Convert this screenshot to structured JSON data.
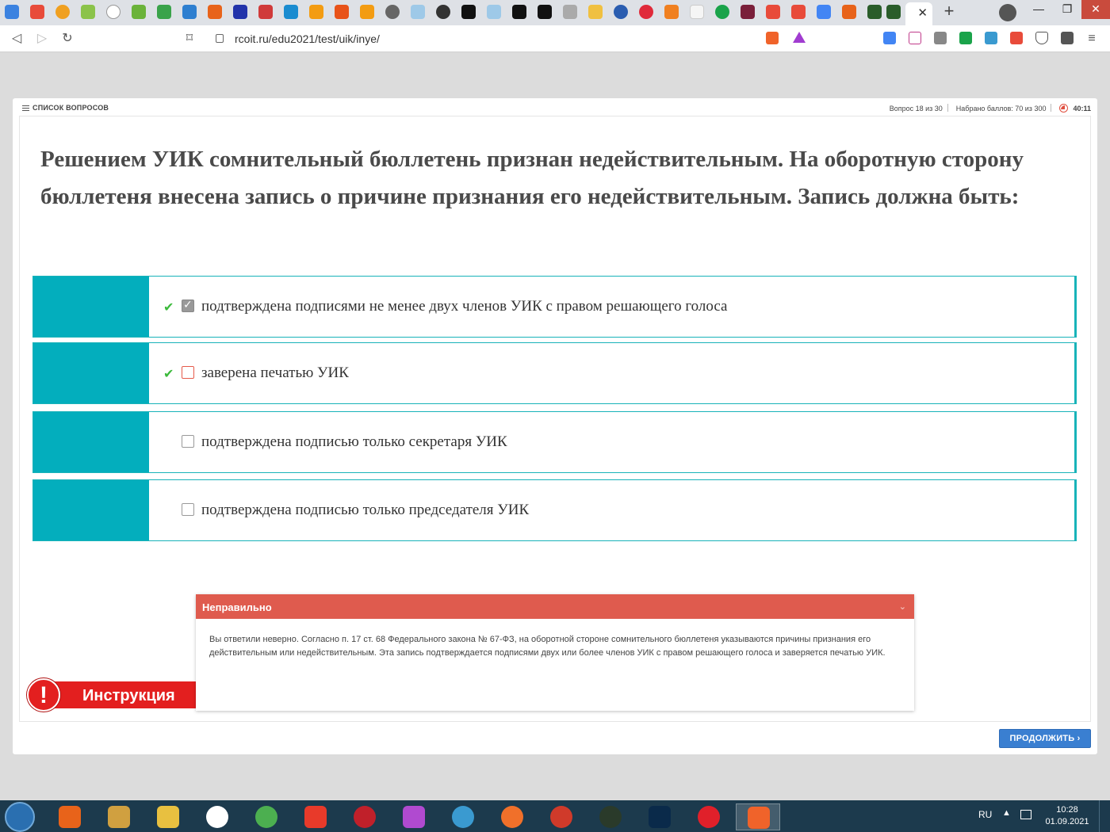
{
  "browser": {
    "url": "rcoit.ru/edu2021/test/uik/inye/",
    "tab_close": "✕",
    "new_tab": "+",
    "window_minimize": "—",
    "window_maximize": "❐",
    "window_close": "✕"
  },
  "header": {
    "question_list": "СПИСОК ВОПРОСОВ",
    "question_counter": "Вопрос 18 из 30",
    "score": "Набрано баллов: 70 из 300",
    "timer": "40:11"
  },
  "question": {
    "text": "Решением УИК сомнительный бюллетень признан недействительным. На оборотную сторону бюллетеня внесена запись о причине признания его недействительным. Запись должна быть:"
  },
  "answers": [
    {
      "label": "подтверждена подписями не менее двух членов УИК с правом решающего голоса",
      "selected": true,
      "correct": true
    },
    {
      "label": "заверена печатью УИК",
      "selected": false,
      "correct": true
    },
    {
      "label": "подтверждена подписью только секретаря УИК",
      "selected": false,
      "correct": false
    },
    {
      "label": "подтверждена подписью только председателя УИК",
      "selected": false,
      "correct": false
    }
  ],
  "feedback": {
    "title": "Неправильно",
    "body": "Вы ответили неверно. Согласно п. 17 ст. 68 Федерального закона № 67-ФЗ, на оборотной стороне сомнительного бюллетеня указываются причины признания его действительным или недействительным. Эта запись подтверждается подписями двух или более членов УИК с правом решающего голоса и заверяется печатью УИК."
  },
  "instruction_label": "Инструкция",
  "continue_button": "ПРОДОЛЖИТЬ ›",
  "taskbar": {
    "language": "RU",
    "time": "10:28",
    "date": "01.09.2021"
  },
  "colors": {
    "teal": "#03aebd",
    "error_red": "#df5b4e",
    "primary_blue": "#3a7fd1",
    "correct_green": "#3cba3c"
  }
}
